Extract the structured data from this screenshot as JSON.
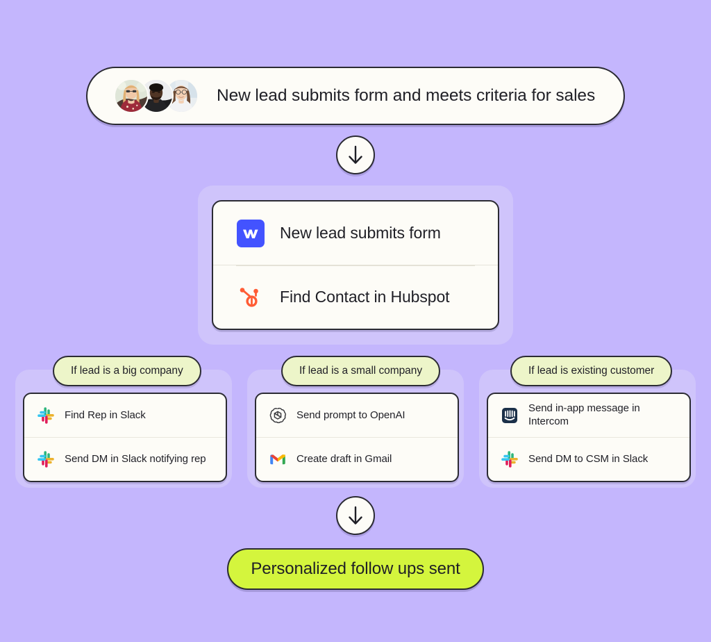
{
  "theme": {
    "background": "#C4B6FD",
    "panel": "#CFC4FB",
    "card": "#FDFCF7",
    "outline": "#2b2b33",
    "condition_pill": "#EDF5C9",
    "result_pill": "#D4F53D"
  },
  "trigger": {
    "label": "New lead submits form and meets criteria for sales",
    "avatars": [
      {
        "name": "avatar-person-1"
      },
      {
        "name": "avatar-person-2"
      },
      {
        "name": "avatar-person-3"
      }
    ]
  },
  "connectors": [
    {
      "icon": "arrow-down-icon",
      "position": "top"
    },
    {
      "icon": "arrow-down-icon",
      "position": "bottom"
    }
  ],
  "main_steps": [
    {
      "icon": "webflow-icon",
      "label": "New lead submits form"
    },
    {
      "icon": "hubspot-icon",
      "label": "Find Contact in Hubspot"
    }
  ],
  "branches": [
    {
      "condition": "If lead is a big company",
      "steps": [
        {
          "icon": "slack-icon",
          "label": "Find Rep in Slack"
        },
        {
          "icon": "slack-icon",
          "label": "Send DM in Slack notifying rep"
        }
      ]
    },
    {
      "condition": "If lead is a small company",
      "steps": [
        {
          "icon": "openai-icon",
          "label": "Send prompt to OpenAI"
        },
        {
          "icon": "gmail-icon",
          "label": "Create draft in Gmail"
        }
      ]
    },
    {
      "condition": "If lead is existing customer",
      "steps": [
        {
          "icon": "intercom-icon",
          "label": "Send in-app message in Intercom"
        },
        {
          "icon": "slack-icon",
          "label": "Send DM to CSM in Slack"
        }
      ]
    }
  ],
  "result": {
    "label": "Personalized follow ups sent"
  }
}
